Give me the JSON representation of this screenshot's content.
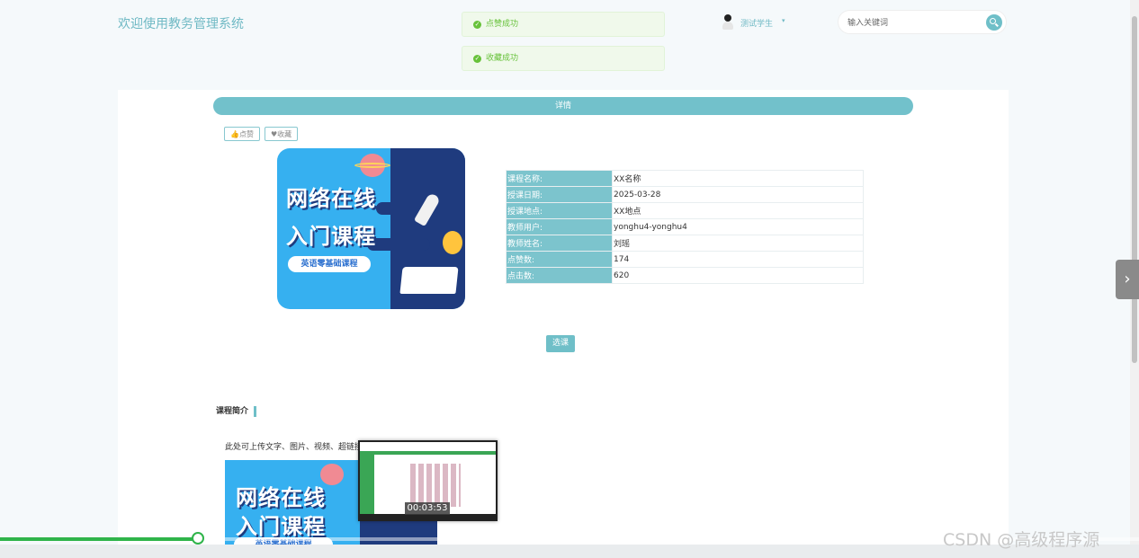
{
  "header": {
    "site_title": "欢迎使用教务管理系统",
    "user_name": "测试学生",
    "user_caret": "▾",
    "search_placeholder": "输入关键词"
  },
  "toasts": [
    {
      "text": "点赞成功",
      "icon": "check-circle-icon"
    },
    {
      "text": "收藏成功",
      "icon": "check-circle-icon"
    }
  ],
  "detail": {
    "bar_title": "详情",
    "like_label": "👍点赞",
    "favorite_label": "♥收藏",
    "image_text": {
      "line1": "网络在线",
      "line2": "入门课程",
      "pill": "英语零基础课程"
    },
    "rows": [
      {
        "key": "课程名称:",
        "value": "XX名称"
      },
      {
        "key": "授课日期:",
        "value": "2025-03-28"
      },
      {
        "key": "授课地点:",
        "value": "XX地点"
      },
      {
        "key": "教师用户:",
        "value": "yonghu4-yonghu4"
      },
      {
        "key": "教师姓名:",
        "value": "刘瑶"
      },
      {
        "key": "点赞数:",
        "value": "174"
      },
      {
        "key": "点击数:",
        "value": "620"
      }
    ],
    "select_label": "选课"
  },
  "intro": {
    "title": "课程简介",
    "text": "此处可上传文字、图片、视频、超链接",
    "image_text": {
      "line1": "网络在线",
      "line2": "入门课程",
      "pill": "英语零基础课程"
    }
  },
  "video": {
    "preview_time": "00:03:53",
    "progress": 0.174
  },
  "overlay": {
    "next_arrow": "›",
    "watermark": "CSDN @高级程序源"
  },
  "colors": {
    "accent": "#6fbfc8",
    "success": "#67c23a",
    "progress": "#2fb44a"
  }
}
